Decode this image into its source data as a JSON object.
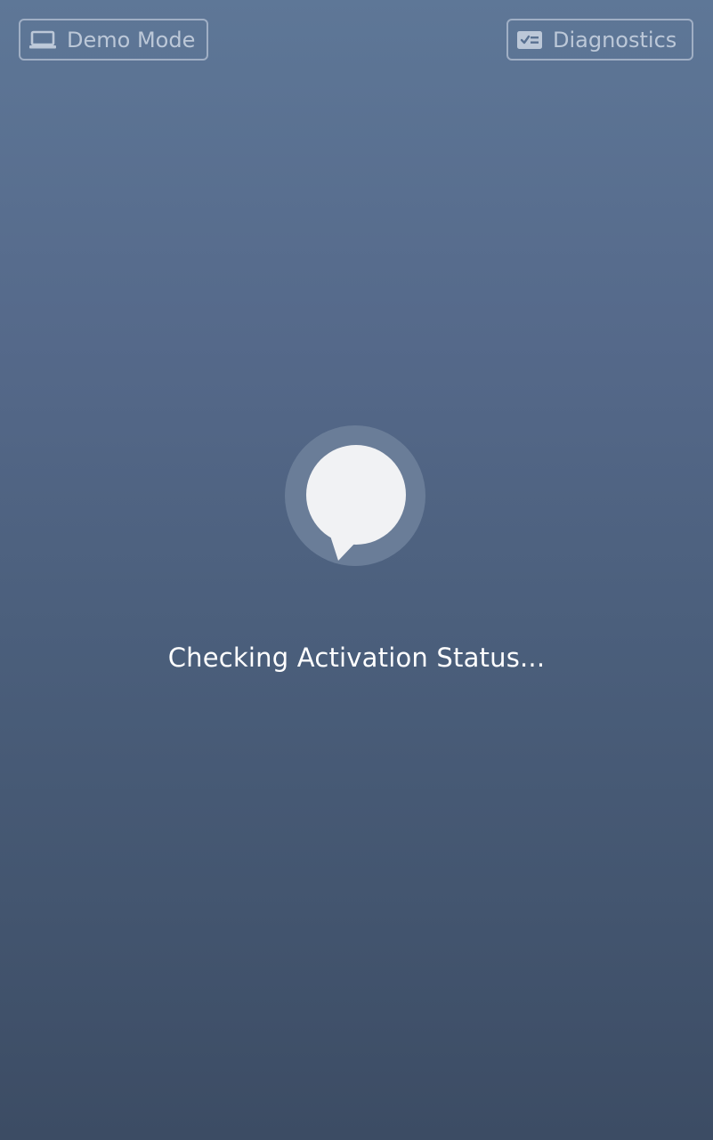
{
  "header": {
    "demo_mode_label": "Demo Mode",
    "demo_mode_icon": "laptop-icon",
    "diagnostics_label": "Diagnostics",
    "diagnostics_icon": "checklist-card-icon"
  },
  "main": {
    "logo_icon": "chat-bubble-icon",
    "status_text": "Checking Activation Status..."
  },
  "colors": {
    "background_top": "#5e7797",
    "background_bottom": "#3c4c64",
    "button_text": "#d7dfeb",
    "logo_fill": "#f1f2f4",
    "logo_ring": "#6a7d98"
  }
}
